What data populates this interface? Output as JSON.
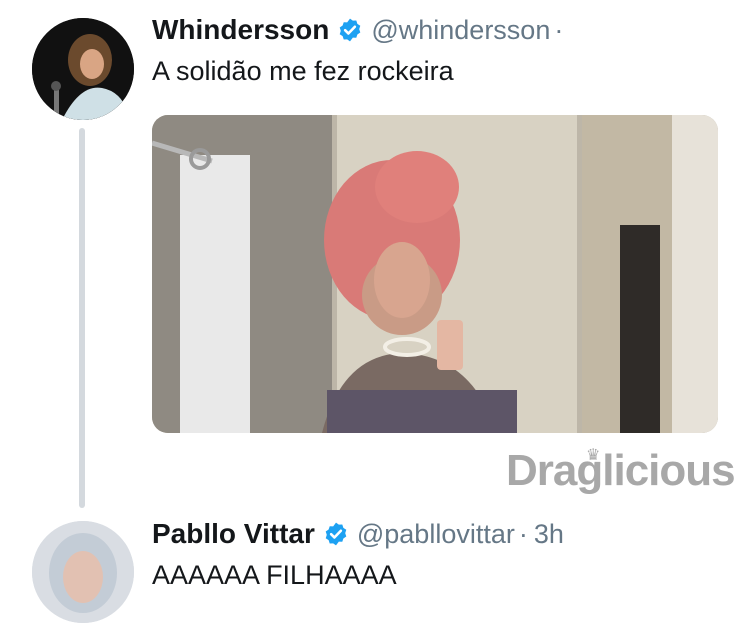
{
  "tweets": [
    {
      "name": "Whindersson",
      "handle": "@whindersson",
      "separator": "·",
      "text": "A solidão me fez rockeira",
      "avatar_icon": "profile-photo"
    },
    {
      "name": "Pabllo Vittar",
      "handle": "@pabllovittar",
      "separator": "·",
      "time": "3h",
      "text": "AAAAAA FILHAAAA",
      "avatar_icon": "profile-photo"
    }
  ],
  "watermark": "Draglicious",
  "colors": {
    "verified": "#1da1f2",
    "name": "#14171a",
    "secondary": "#657786",
    "thread_line": "#d4d9de"
  }
}
